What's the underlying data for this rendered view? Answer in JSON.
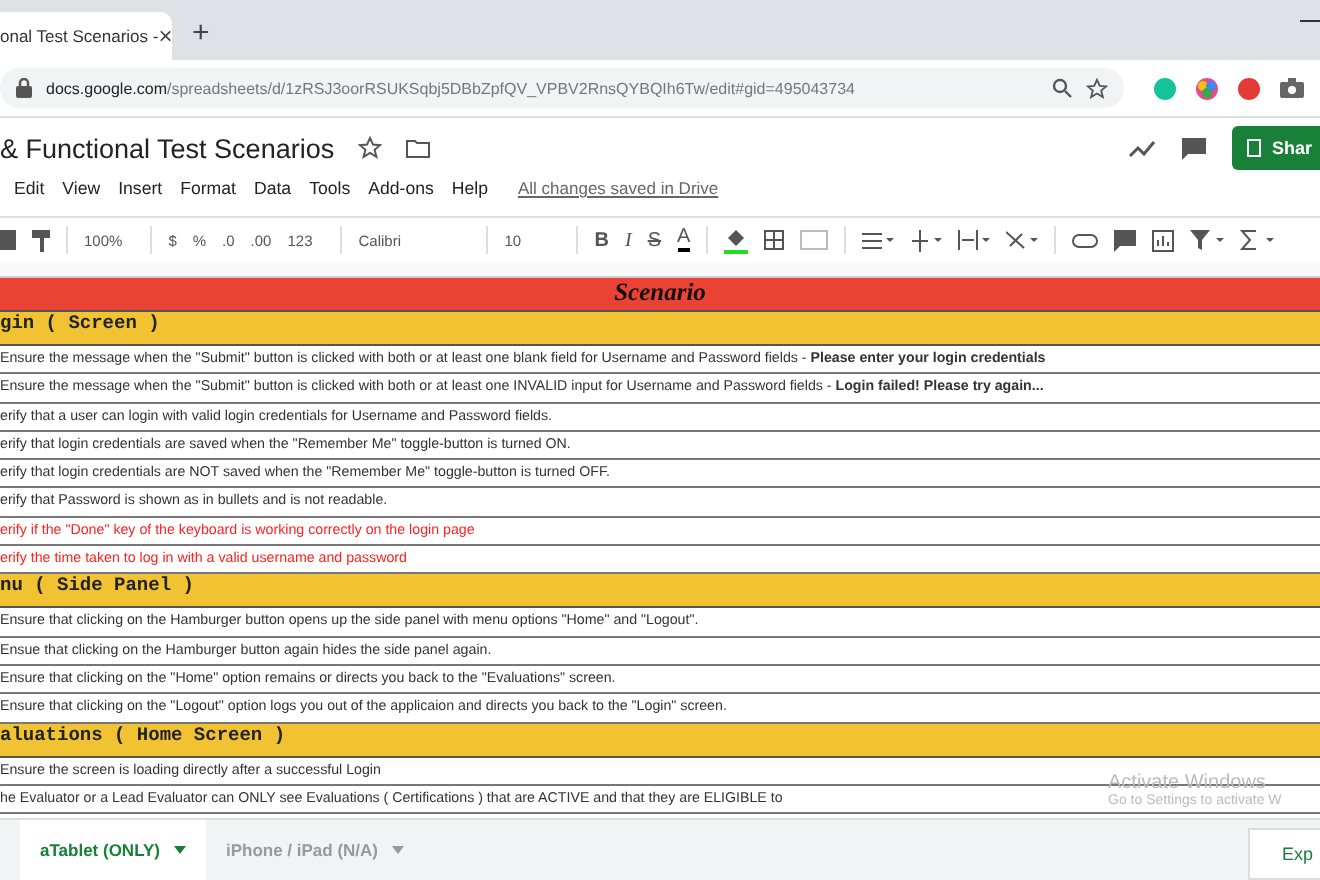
{
  "browser": {
    "tab_title": "onal Test Scenarios - ",
    "tab_close": "×",
    "new_tab": "+",
    "url_host": "docs.google.com",
    "url_path": "/spreadsheets/d/1zRSJ3oorRSUKSqbj5DBbZpfQV_VPBV2RnsQYBQIh6Tw/edit#gid=495043734"
  },
  "doc": {
    "title": "& Functional Test Scenarios",
    "menu": [
      "Edit",
      "View",
      "Insert",
      "Format",
      "Data",
      "Tools",
      "Add-ons",
      "Help"
    ],
    "save_status": "All changes saved in Drive",
    "share": "Shar"
  },
  "toolbar": {
    "zoom": "100%",
    "currency": "$",
    "percent": "%",
    "dec_less": ".0",
    "dec_more": ".00",
    "format": "123",
    "font": "Calibri",
    "size": "10",
    "bold": "B",
    "italic": "I",
    "strike": "S",
    "text_color": "A"
  },
  "sheet": {
    "header": "Scenario",
    "rows": [
      {
        "kind": "section",
        "text": "gin ( Screen )"
      },
      {
        "kind": "item",
        "color": "#333333",
        "text": "Ensure the message when the \"Submit\" button is clicked with both or at least one blank field for Username and Password fields - **Please enter your login credentials**"
      },
      {
        "kind": "item",
        "color": "#333333",
        "text": "Ensure the message when the \"Submit\" button is clicked with both or at least one INVALID input for Username and Password fields - **Login failed! Please try again...**"
      },
      {
        "kind": "item",
        "color": "#333333",
        "text": "erify that a user can login with valid login credentials for Username and Password fields."
      },
      {
        "kind": "item",
        "color": "#333333",
        "text": "erify that login credentials are saved when the \"Remember Me\" toggle-button is turned ON."
      },
      {
        "kind": "item",
        "color": "#333333",
        "text": "erify that login credentials are NOT saved when the \"Remember Me\" toggle-button is turned OFF."
      },
      {
        "kind": "item",
        "color": "#333333",
        "text": "erify that Password is shown as in bullets and is not readable."
      },
      {
        "kind": "item",
        "color": "#ff2020",
        "text": "erify if the \"Done\" key of the keyboard is working correctly on the login page"
      },
      {
        "kind": "item",
        "color": "#ff2020",
        "text": "erify the time taken to log in with a valid username and password"
      },
      {
        "kind": "section",
        "text": "nu ( Side Panel )"
      },
      {
        "kind": "item",
        "color": "#333333",
        "text": "Ensure that clicking on the Hamburger button opens up the side panel with menu options \"Home\" and \"Logout\"."
      },
      {
        "kind": "item",
        "color": "#333333",
        "text": "Ensue that clicking on the Hamburger button again hides the side panel again."
      },
      {
        "kind": "item",
        "color": "#333333",
        "text": "Ensure that clicking on the \"Home\" option remains or directs you back to the \"Evaluations\" screen."
      },
      {
        "kind": "item",
        "color": "#333333",
        "text": "Ensure that clicking on the \"Logout\" option logs you out of the applicaion and directs you back to the \"Login\" screen."
      },
      {
        "kind": "section",
        "text": "aluations ( Home Screen )"
      },
      {
        "kind": "item",
        "color": "#333333",
        "text": "Ensure the screen is loading directly after a successful Login"
      },
      {
        "kind": "item",
        "color": "#333333",
        "text": "he Evaluator or a Lead Evaluator can ONLY see Evaluations ( Certifications ) that are ACTIVE and that they are ELIGIBLE to"
      }
    ]
  },
  "sheet_tabs": [
    {
      "label": "aTablet (ONLY)",
      "selected": true
    },
    {
      "label": "iPhone / iPad (N/A)",
      "selected": false
    }
  ],
  "explore": "Exp",
  "activation": {
    "title": "Activate Windows",
    "hint": "Go to Settings to activate W"
  }
}
